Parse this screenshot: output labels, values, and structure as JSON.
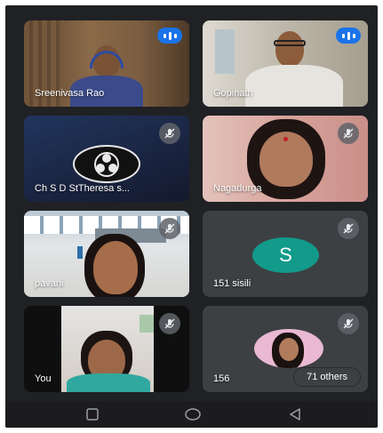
{
  "participants": [
    {
      "name": "Sreenivasa Rao",
      "status": "speaking"
    },
    {
      "name": "Gopinath",
      "status": "speaking"
    },
    {
      "name": "Ch S D StTheresa s...",
      "status": "muted"
    },
    {
      "name": "Nagadurga",
      "status": "muted"
    },
    {
      "name": "pavani",
      "status": "muted"
    },
    {
      "name": "151 sisili",
      "status": "muted",
      "avatar_letter": "S",
      "avatar_color": "#129a8a"
    },
    {
      "name": "You",
      "status": "muted"
    },
    {
      "name": "156",
      "status": "muted"
    }
  ],
  "others_label": "71 others",
  "icons": {
    "speaking": "audio-level-icon",
    "muted": "mic-off-icon",
    "nav_recents": "square-icon",
    "nav_home": "circle-icon",
    "nav_back": "triangle-back-icon"
  },
  "colors": {
    "background": "#202124",
    "tile": "#3c4043",
    "speaking_badge": "#1a73e8"
  }
}
